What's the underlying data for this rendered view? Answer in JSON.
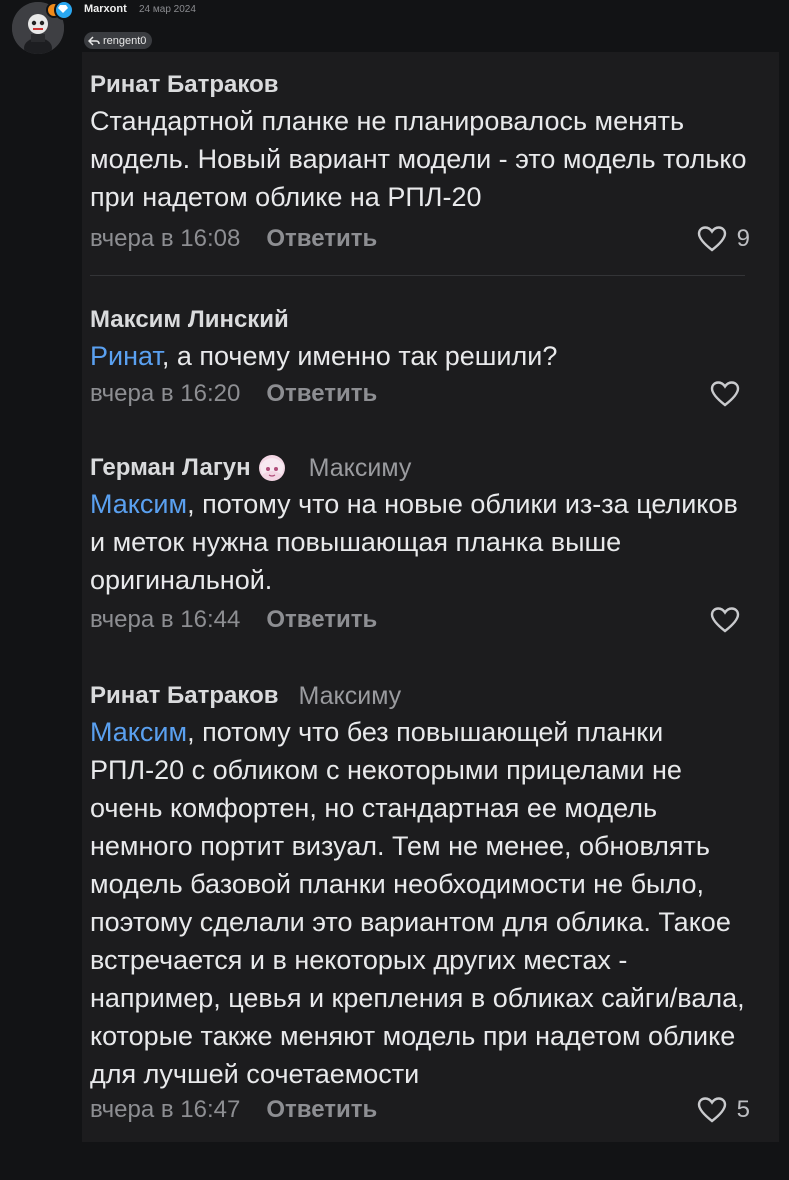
{
  "post": {
    "username": "Marxont",
    "date": "24 мар 2024",
    "reply_to": "rengent0"
  },
  "comments": [
    {
      "author": "Ринат Батраков",
      "addressee": "",
      "mention": "",
      "text": "Стандартной планке не планировалось менять модель. Новый вариант модели - это модель только при надетом облике на РПЛ-20",
      "time": "вчера в 16:08",
      "reply_label": "Ответить",
      "likes": "9"
    },
    {
      "author": "Максим Линский",
      "addressee": "",
      "mention": "Ринат",
      "text": ", а почему именно так решили?",
      "time": "вчера в 16:20",
      "reply_label": "Ответить",
      "likes": ""
    },
    {
      "author": "Герман Лагун",
      "addressee": "Максиму",
      "mention": "Максим",
      "text": ", потому что на новые облики из-за целиков и меток нужна повышающая планка выше оригинальной.",
      "time": "вчера в 16:44",
      "reply_label": "Ответить",
      "likes": ""
    },
    {
      "author": "Ринат Батраков",
      "addressee": "Максиму",
      "mention": "Максим",
      "text": ", потому что без повышающей планки РПЛ-20 с обликом с некоторыми прицелами не очень комфортен, но стандартная ее модель немного портит визуал. Тем не менее, обновлять модель базовой планки необходимости не было, поэтому сделали это вариантом для облика. Такое встречается и в некоторых других местах - например, цевья и крепления в обликах сайги/вала, которые также меняют модель при надетом облике для лучшей сочетаемости",
      "time": "вчера в 16:47",
      "reply_label": "Ответить",
      "likes": "5"
    }
  ],
  "colors": {
    "background": "#121315",
    "panel": "#1c1c1e",
    "mention": "#5aa0f0",
    "badge_orange": "#f08a1a",
    "badge_blue": "#2aa7f0"
  },
  "icons": [
    "reply-arrow-icon",
    "heart-icon",
    "diamond-icon"
  ]
}
